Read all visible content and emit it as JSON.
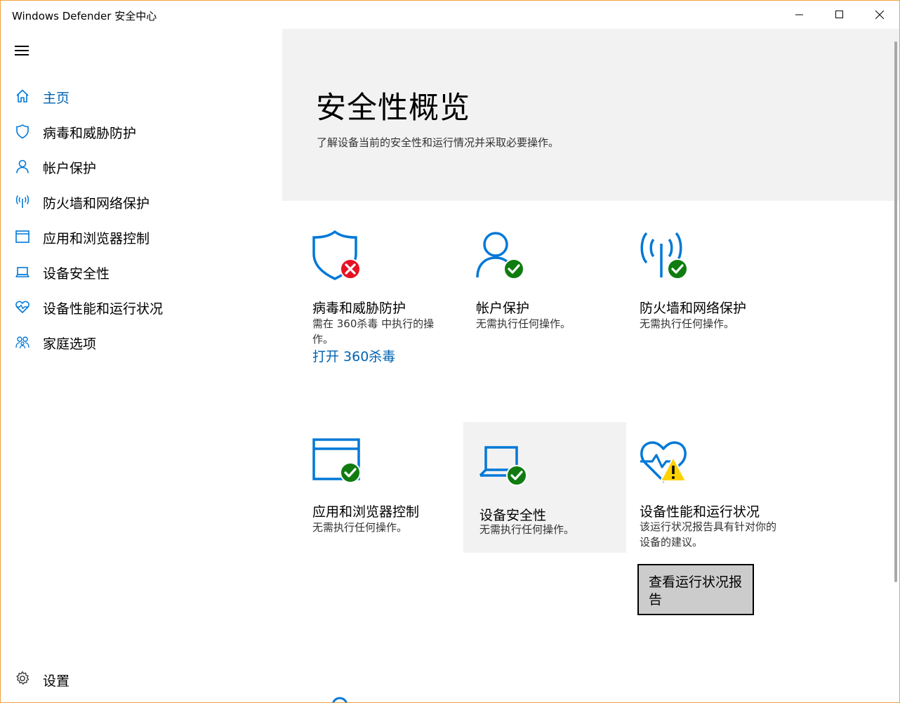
{
  "window": {
    "title": "Windows Defender 安全中心",
    "controls": {
      "minimize": "minimize",
      "maximize": "maximize",
      "close": "close"
    }
  },
  "sidebar": {
    "menu_icon": "hamburger-icon",
    "items": [
      {
        "label": "主页",
        "icon": "home-icon",
        "active": true
      },
      {
        "label": "病毒和威胁防护",
        "icon": "shield-icon",
        "active": false
      },
      {
        "label": "帐户保护",
        "icon": "person-icon",
        "active": false
      },
      {
        "label": "防火墙和网络保护",
        "icon": "wireless-antenna-icon",
        "active": false
      },
      {
        "label": "应用和浏览器控制",
        "icon": "browser-window-icon",
        "active": false
      },
      {
        "label": "设备安全性",
        "icon": "laptop-icon",
        "active": false
      },
      {
        "label": "设备性能和运行状况",
        "icon": "heart-pulse-icon",
        "active": false
      },
      {
        "label": "家庭选项",
        "icon": "family-icon",
        "active": false
      }
    ],
    "settings": {
      "label": "设置",
      "icon": "gear-icon"
    }
  },
  "hero": {
    "title": "安全性概览",
    "subtitle": "了解设备当前的安全性和运行情况并采取必要操作。"
  },
  "tiles": [
    {
      "title": "病毒和威胁防护",
      "desc": "需在 360杀毒 中执行的操作。",
      "link": "打开 360杀毒",
      "icon": "shield-icon",
      "status": "error"
    },
    {
      "title": "帐户保护",
      "desc": "无需执行任何操作。",
      "icon": "person-icon",
      "status": "ok"
    },
    {
      "title": "防火墙和网络保护",
      "desc": "无需执行任何操作。",
      "icon": "wireless-antenna-icon",
      "status": "ok"
    },
    {
      "title": "应用和浏览器控制",
      "desc": "无需执行任何操作。",
      "icon": "browser-window-icon",
      "status": "ok"
    },
    {
      "title": "设备安全性",
      "desc": "无需执行任何操作。",
      "icon": "laptop-icon",
      "status": "ok"
    },
    {
      "title": "设备性能和运行状况",
      "desc": "该运行状况报告具有针对你的设备的建议。",
      "button": "查看运行状况报告",
      "icon": "heart-pulse-icon",
      "status": "warning"
    }
  ],
  "colors": {
    "accent": "#0063b1",
    "icon_blue": "#0078d7",
    "ok": "#107c10",
    "error": "#e81123",
    "warning": "#ffd100",
    "hero_bg": "#f2f2f2"
  }
}
